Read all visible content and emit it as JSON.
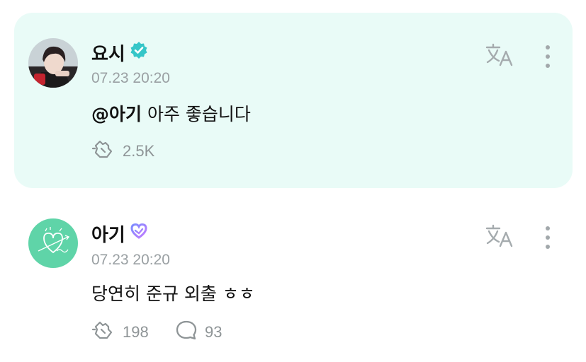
{
  "post": {
    "author": "요시",
    "verified_icon": "verified-badge-icon",
    "time": "07.23 20:20",
    "mention": "@아기",
    "text": " 아주 좋습니다",
    "likes": "2.5K",
    "translate_icon": "translate-icon",
    "more_icon": "more-vertical-icon",
    "colors": {
      "card_bg": "#e9fbf7",
      "badge": "#35c6c8"
    }
  },
  "reply": {
    "author": "아기",
    "badge_icon": "heart-badge-icon",
    "time": "07.23 20:20",
    "text": "당연히 준규 외출 ㅎㅎ",
    "likes": "198",
    "comments": "93",
    "translate_icon": "translate-icon",
    "more_icon": "more-vertical-icon",
    "colors": {
      "avatar_bg": "#5fd4a8"
    }
  }
}
